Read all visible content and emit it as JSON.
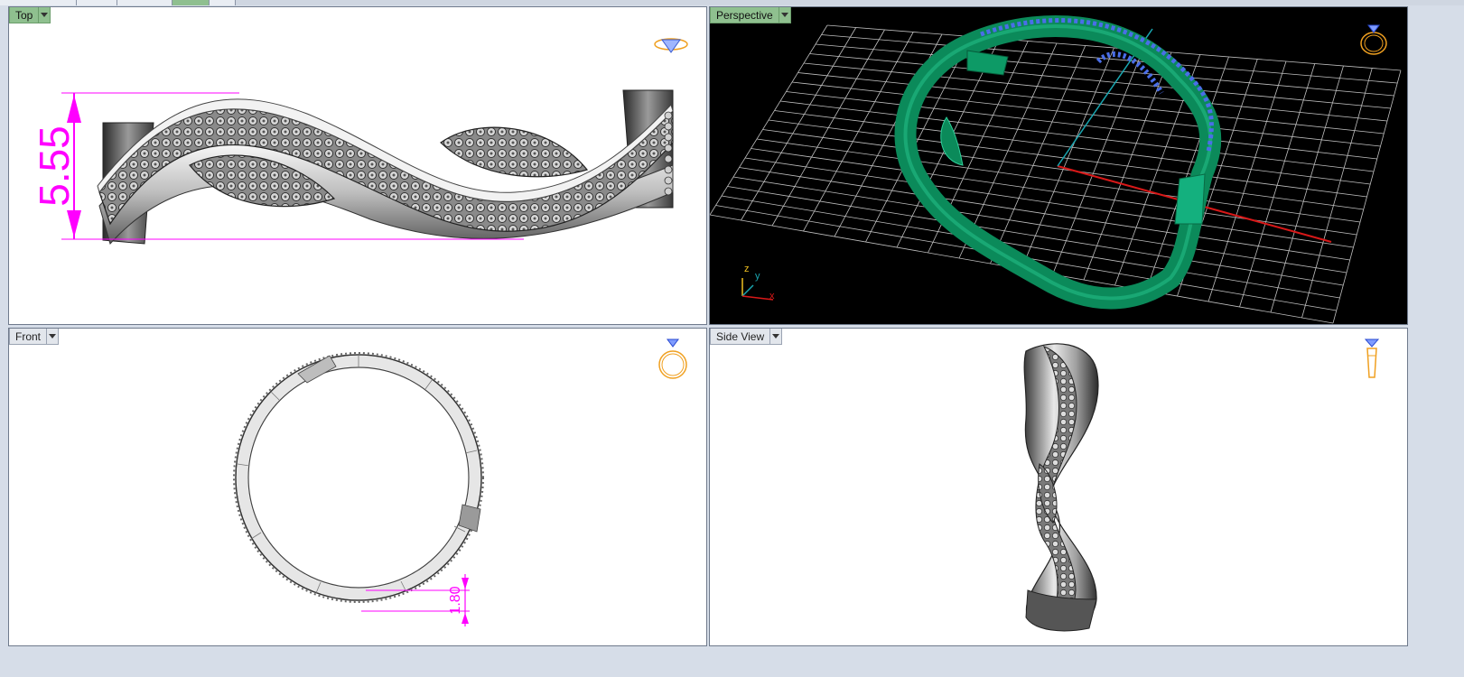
{
  "viewports": {
    "top": {
      "label": "Top",
      "dimension": "5.55"
    },
    "perspective": {
      "label": "Perspective",
      "axes": {
        "z": "z",
        "y": "y",
        "x": "x"
      }
    },
    "front": {
      "label": "Front",
      "dimension": "1.80"
    },
    "side": {
      "label": "Side View"
    }
  },
  "icons": {
    "top_corner": "diamond-side-icon",
    "perspective_corner": "ring-3d-icon",
    "front_corner": "ring-front-icon",
    "side_corner": "ring-side-icon",
    "dropdown": "chevron-down-icon"
  },
  "colors": {
    "dimension": "#ff00ff",
    "model_green": "#0b8a5a",
    "gems_blue": "#4a6ee8",
    "x_axis": "#d81818",
    "y_axis": "#1aa6b0",
    "icon_gold": "#f0a020",
    "active_label": "#8fc08f"
  }
}
